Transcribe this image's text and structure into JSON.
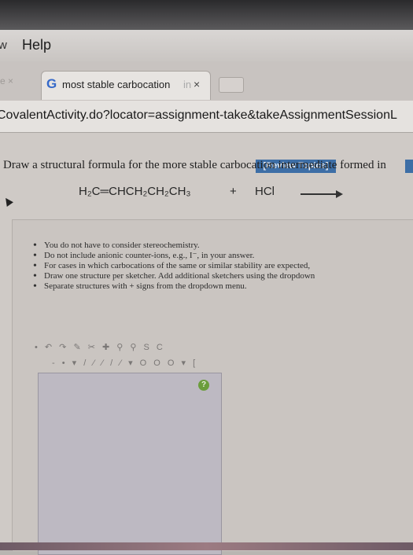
{
  "menubar": {
    "window_label_fragment": "w",
    "help_label": "Help"
  },
  "tabs": {
    "prev_tab_fragment": "e ×",
    "prev_tab_close": "×",
    "active_tab_icon": "G",
    "active_tab_title": "most stable carbocation",
    "active_tab_fade": "in",
    "active_tab_close": "×"
  },
  "urlbar": {
    "url": "CovalentActivity.do?locator=assignment-take&takeAssignmentSessionL"
  },
  "page": {
    "review_topics": "[Review Topics]",
    "question": "Draw a structural formula for the more stable carbocation intermediate formed in",
    "reaction": {
      "reactant": "H₂C═CHCH₂CH₂CH₃",
      "plus": "+",
      "reagent": "HCl"
    },
    "instructions": [
      "You do not have to consider stereochemistry.",
      "Do not include anionic counter-ions, e.g., I⁻, in your answer.",
      "For cases in which carbocations of the same or similar stability are expected,",
      "Draw one structure per sketcher. Add additional sketchers using the dropdown",
      "Separate structures with + signs from the dropdown menu."
    ],
    "sketcher": {
      "toolbar_top": "• ↶ ↷ ✎ ✂ ✚ ⚲ ⚲ S C",
      "toolbar_bottom": "- • ▾ / ⁄ ⁄ / ⁄ ▾ O O O ▾ [",
      "help_icon": "?"
    }
  },
  "colors": {
    "review_badge": "#3d6ea6",
    "google_g": "#3569c9",
    "help_icon": "#6b9d3c"
  }
}
